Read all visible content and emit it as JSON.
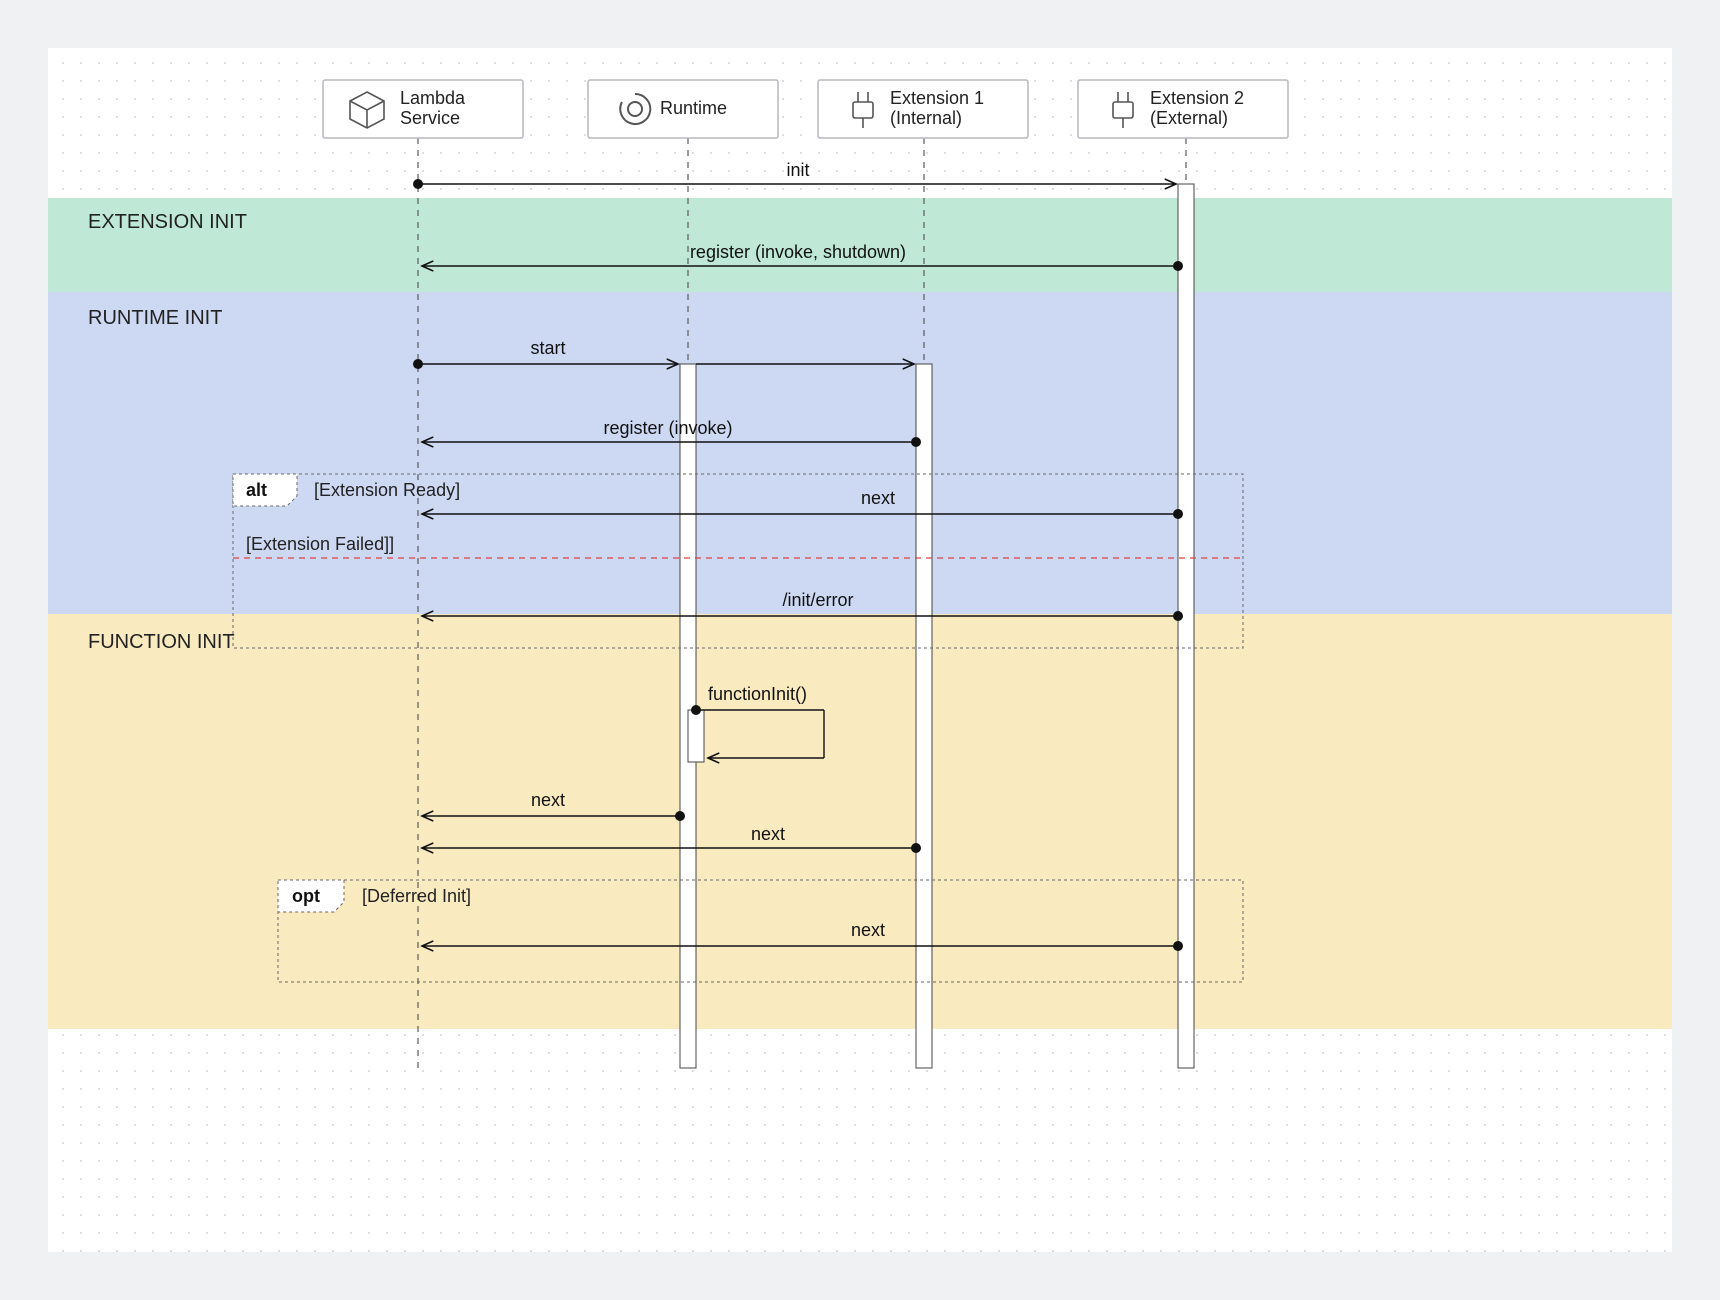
{
  "actors": {
    "a0": {
      "label1": "Lambda",
      "label2": "Service"
    },
    "a1": {
      "label1": "Runtime",
      "label2": ""
    },
    "a2": {
      "label1": "Extension 1",
      "label2": "(Internal)"
    },
    "a3": {
      "label1": "Extension 2",
      "label2": "(External)"
    }
  },
  "phases": {
    "p1": "EXTENSION INIT",
    "p2": "RUNTIME INIT",
    "p3": "FUNCTION INIT"
  },
  "messages": {
    "m_init": "init",
    "m_register_is": "register (invoke, shutdown)",
    "m_start": "start",
    "m_register_i": "register (invoke)",
    "m_next": "next",
    "m_init_error": "/init/error",
    "m_funcinit": "functionInit()"
  },
  "frames": {
    "alt_label": "alt",
    "alt_guard1": "[Extension Ready]",
    "alt_guard2": "[Extension Failed]]",
    "opt_label": "opt",
    "opt_guard": "[Deferred Init]"
  }
}
